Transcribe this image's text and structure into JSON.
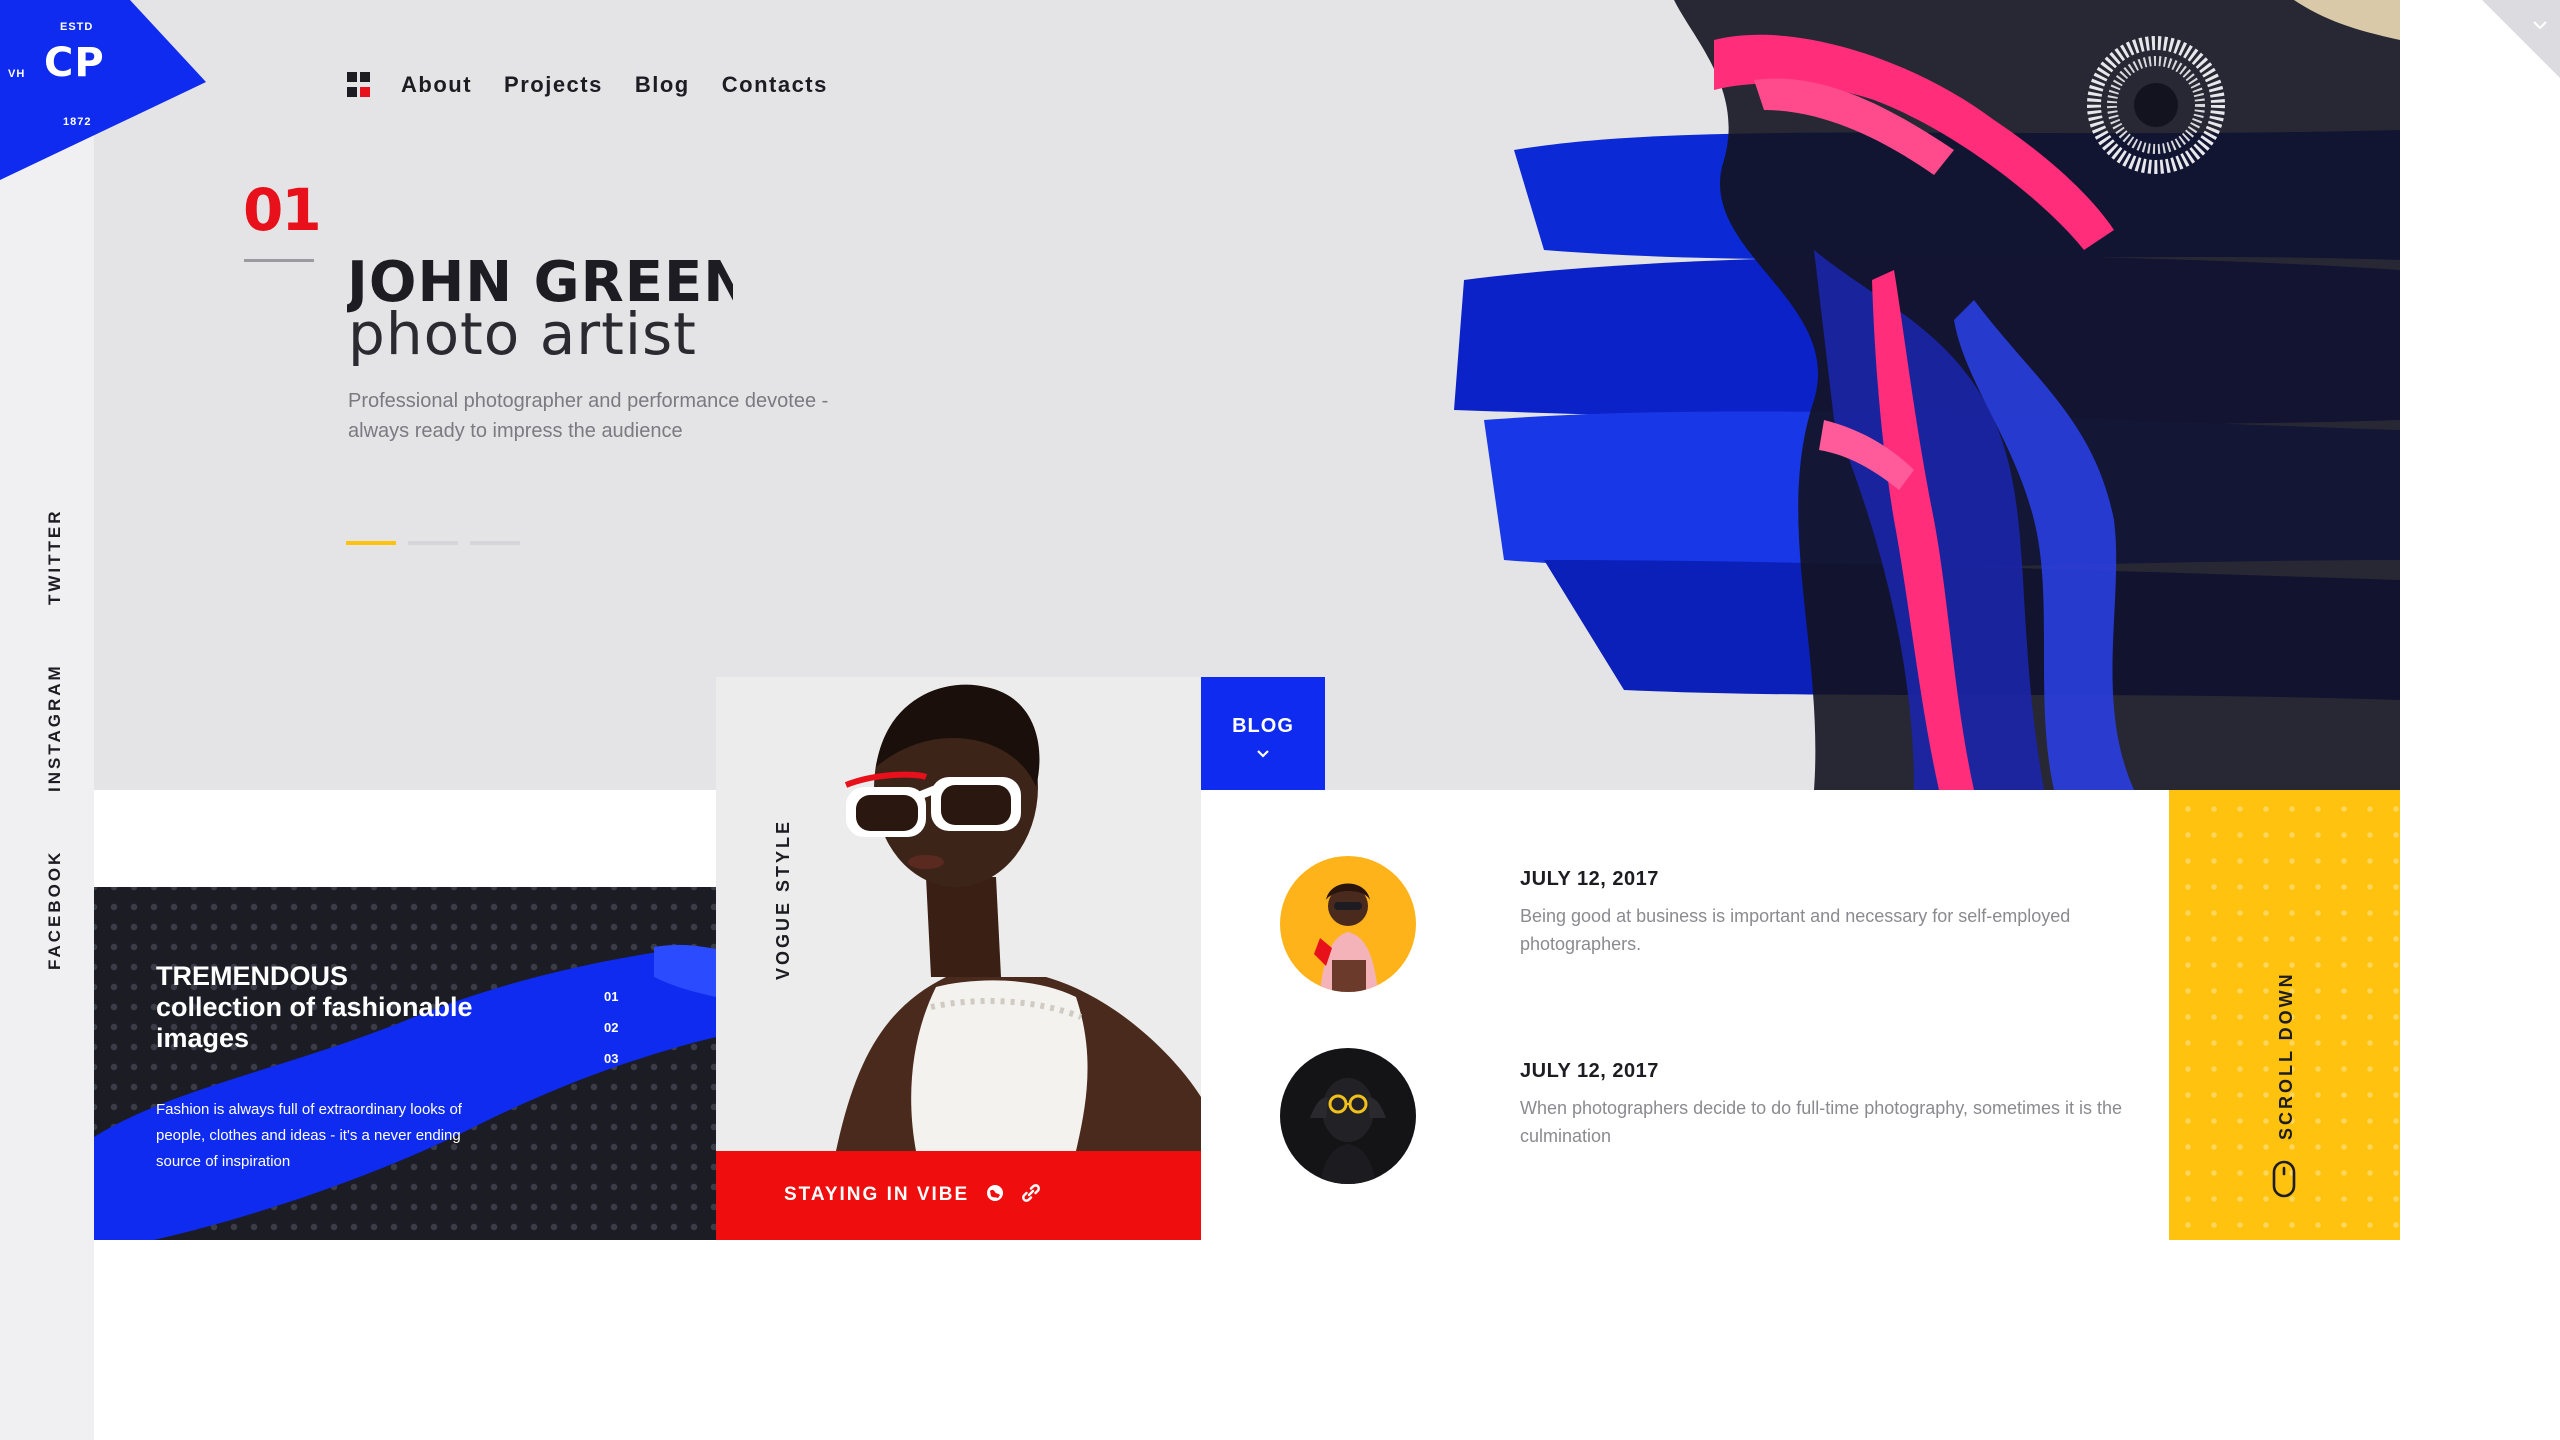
{
  "logo": {
    "estd": "ESTD",
    "initials": "CP",
    "side": "VH",
    "year": "1872"
  },
  "nav": {
    "items": [
      "About",
      "Projects",
      "Blog",
      "Contacts"
    ]
  },
  "social": [
    "TWITTER",
    "INSTAGRAM",
    "FACEBOOK"
  ],
  "hero": {
    "slide_number": "01",
    "title": "JOHN GREEN",
    "subtitle": "photo artist",
    "description": "Professional photographer and performance devotee - always ready to impress the audience",
    "slide_count": 3,
    "active_slide": 1
  },
  "feature": {
    "title": "TREMENDOUS collection of fashionable images",
    "description": "Fashion is always full of extraordinary looks of people, clothes and ideas - it's a never ending source of inspiration",
    "numbers": [
      "01",
      "02",
      "03"
    ]
  },
  "photo_card": {
    "vertical_label": "VOGUE STYLE",
    "bar_label": "STAYING IN VIBE",
    "icons": [
      "globe-icon",
      "link-icon"
    ]
  },
  "blog": {
    "tab_label": "BLOG",
    "posts": [
      {
        "date": "JULY 12, 2017",
        "text": "Being good at business is important and necessary for self-employed photographers."
      },
      {
        "date": "JULY 12, 2017",
        "text": "When photographers decide to do full-time photography, sometimes it is the culmination"
      }
    ]
  },
  "scroll": {
    "label": "SCROLL DOWN"
  },
  "colors": {
    "blue": "#0f2bf0",
    "red": "#f00d0d",
    "yellow": "#ffc20e",
    "dark": "#1b1c24",
    "pink": "#ff2d7a"
  }
}
